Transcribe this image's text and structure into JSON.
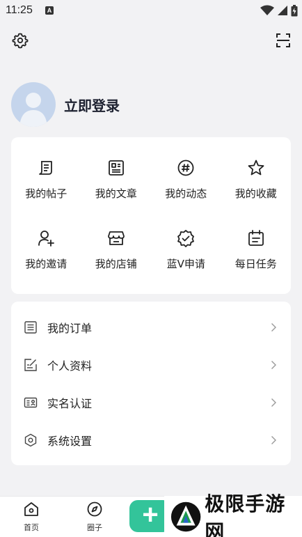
{
  "status_bar": {
    "time": "11:25",
    "notification_badge": "A"
  },
  "top_bar": {
    "left_icon": "settings-gear-icon",
    "right_icon": "scan-icon"
  },
  "profile": {
    "login_text": "立即登录"
  },
  "grid": [
    {
      "label": "我的帖子",
      "icon": "post-icon"
    },
    {
      "label": "我的文章",
      "icon": "article-icon"
    },
    {
      "label": "我的动态",
      "icon": "hashtag-icon"
    },
    {
      "label": "我的收藏",
      "icon": "star-icon"
    },
    {
      "label": "我的邀请",
      "icon": "invite-user-icon"
    },
    {
      "label": "我的店铺",
      "icon": "store-icon"
    },
    {
      "label": "蓝V申请",
      "icon": "verified-badge-icon"
    },
    {
      "label": "每日任务",
      "icon": "calendar-task-icon"
    }
  ],
  "menu": [
    {
      "label": "我的订单",
      "icon": "order-list-icon"
    },
    {
      "label": "个人资料",
      "icon": "edit-profile-icon"
    },
    {
      "label": "实名认证",
      "icon": "id-card-icon"
    },
    {
      "label": "系统设置",
      "icon": "settings-hexagon-icon"
    }
  ],
  "tabbar": {
    "tabs": [
      {
        "label": "首页",
        "icon": "home-icon"
      },
      {
        "label": "圈子",
        "icon": "compass-icon"
      }
    ],
    "fab_label": "+"
  },
  "watermark": {
    "text": "极限手游网"
  },
  "colors": {
    "accent": "#33c49a",
    "avatar_bg": "#c5d5ec",
    "background": "#f2f2f4"
  }
}
